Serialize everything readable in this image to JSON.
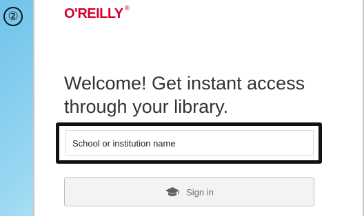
{
  "step": {
    "number": "②"
  },
  "brand": {
    "name": "O'REILLY",
    "mark": "®"
  },
  "welcome": {
    "line1": "Welcome! Get instant access",
    "line2": "through your library."
  },
  "search": {
    "placeholder": "School or institution name",
    "value": ""
  },
  "signin": {
    "label": "Sign in",
    "icon": "graduation-cap-icon"
  }
}
